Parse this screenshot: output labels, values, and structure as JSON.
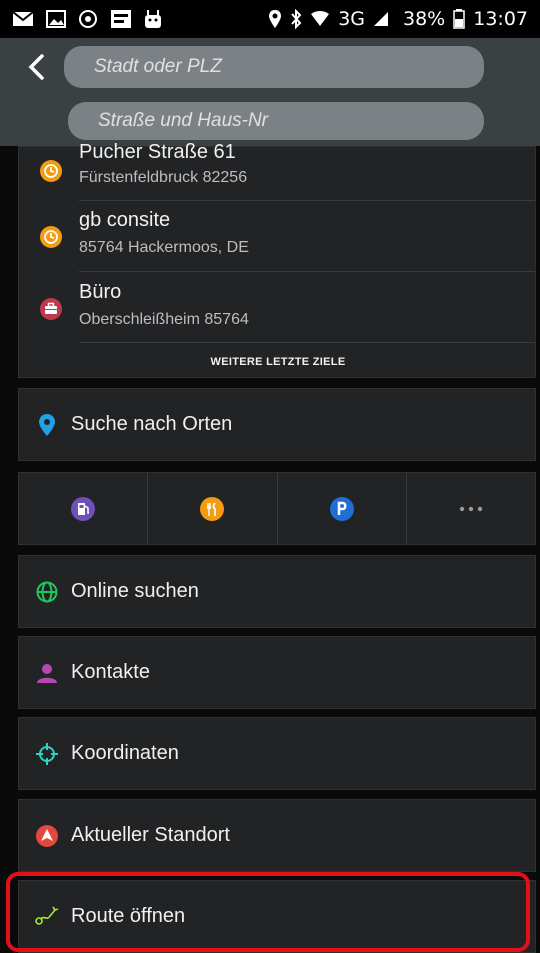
{
  "status_bar": {
    "network": "3G",
    "battery": "38%",
    "time": "13:07"
  },
  "search": {
    "city_placeholder": "Stadt oder PLZ",
    "street_placeholder": "Straße und Haus-Nr"
  },
  "recent": {
    "items": [
      {
        "title": "Pucher Straße 61",
        "subtitle": "Fürstenfeldbruck 82256",
        "icon": "clock-icon"
      },
      {
        "title": "gb consite",
        "subtitle": "85764 Hackermoos, DE",
        "icon": "clock-icon"
      },
      {
        "title": "Büro",
        "subtitle": "Oberschleißheim 85764",
        "icon": "briefcase-icon"
      }
    ],
    "more_label": "WEITERE LETZTE ZIELE"
  },
  "menu": {
    "search_places": "Suche nach Orten",
    "online_search": "Online suchen",
    "contacts": "Kontakte",
    "coordinates": "Koordinaten",
    "current_location": "Aktueller Standort",
    "open_route": "Route öffnen"
  },
  "categories": [
    {
      "icon": "fuel-station-icon",
      "color": "#6f4fb8"
    },
    {
      "icon": "restaurant-icon",
      "color": "#f39c12"
    },
    {
      "icon": "parking-icon",
      "color": "#1e6ed6"
    },
    {
      "icon": "more-dots-icon",
      "color": "#9a9a9a"
    }
  ],
  "colors": {
    "header": "#3b4043",
    "card": "#222325",
    "highlight": "#e3101a"
  }
}
